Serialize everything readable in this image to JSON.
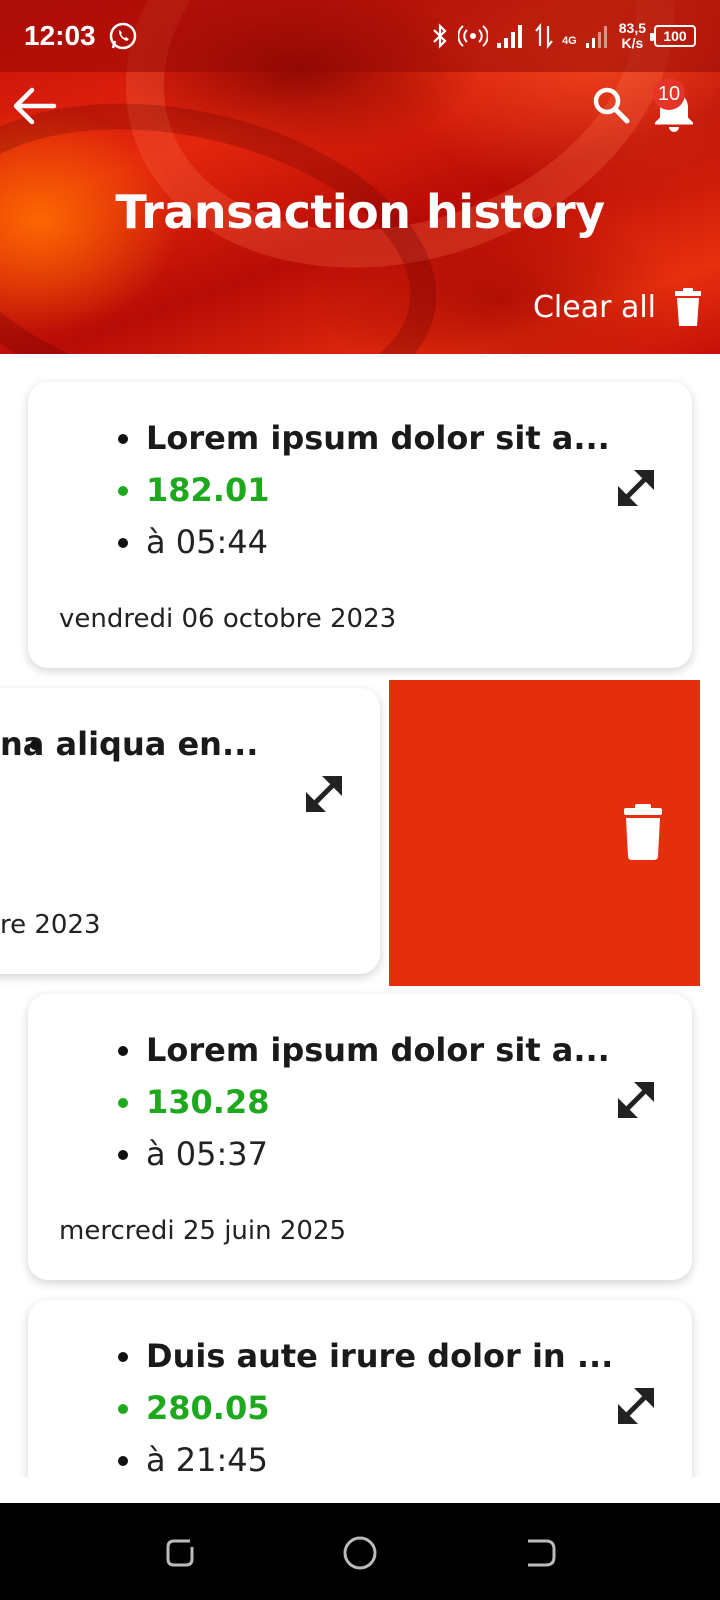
{
  "status_bar": {
    "time": "12:03",
    "network": "4G",
    "speed_value": "83,5",
    "speed_unit": "K/s",
    "battery": "100"
  },
  "app_bar": {
    "title": "Transaction history",
    "notification_count": "10",
    "clear_all_label": "Clear all",
    "icons": [
      "back-arrow-icon",
      "search-icon",
      "bell-icon",
      "trash-icon"
    ]
  },
  "transactions": [
    {
      "title": "Lorem ipsum dolor sit a...",
      "amount": "182.01",
      "time": " à 05:44",
      "date": "vendredi 06 octobre 2023"
    },
    {
      "title": "na aliqua en...",
      "date": "re 2023",
      "swiped": true
    },
    {
      "title": "Lorem ipsum dolor sit a...",
      "amount": "130.28",
      "time": " à 05:37",
      "date": "mercredi 25 juin 2025"
    },
    {
      "title": "Duis aute irure dolor in ...",
      "amount": "280.05",
      "time": " à 21:45"
    }
  ],
  "colors": {
    "header_red": "#d41a0a",
    "amount_green": "#1ea81e",
    "delete_red": "#e52e0c",
    "badge_red": "#e53529"
  }
}
